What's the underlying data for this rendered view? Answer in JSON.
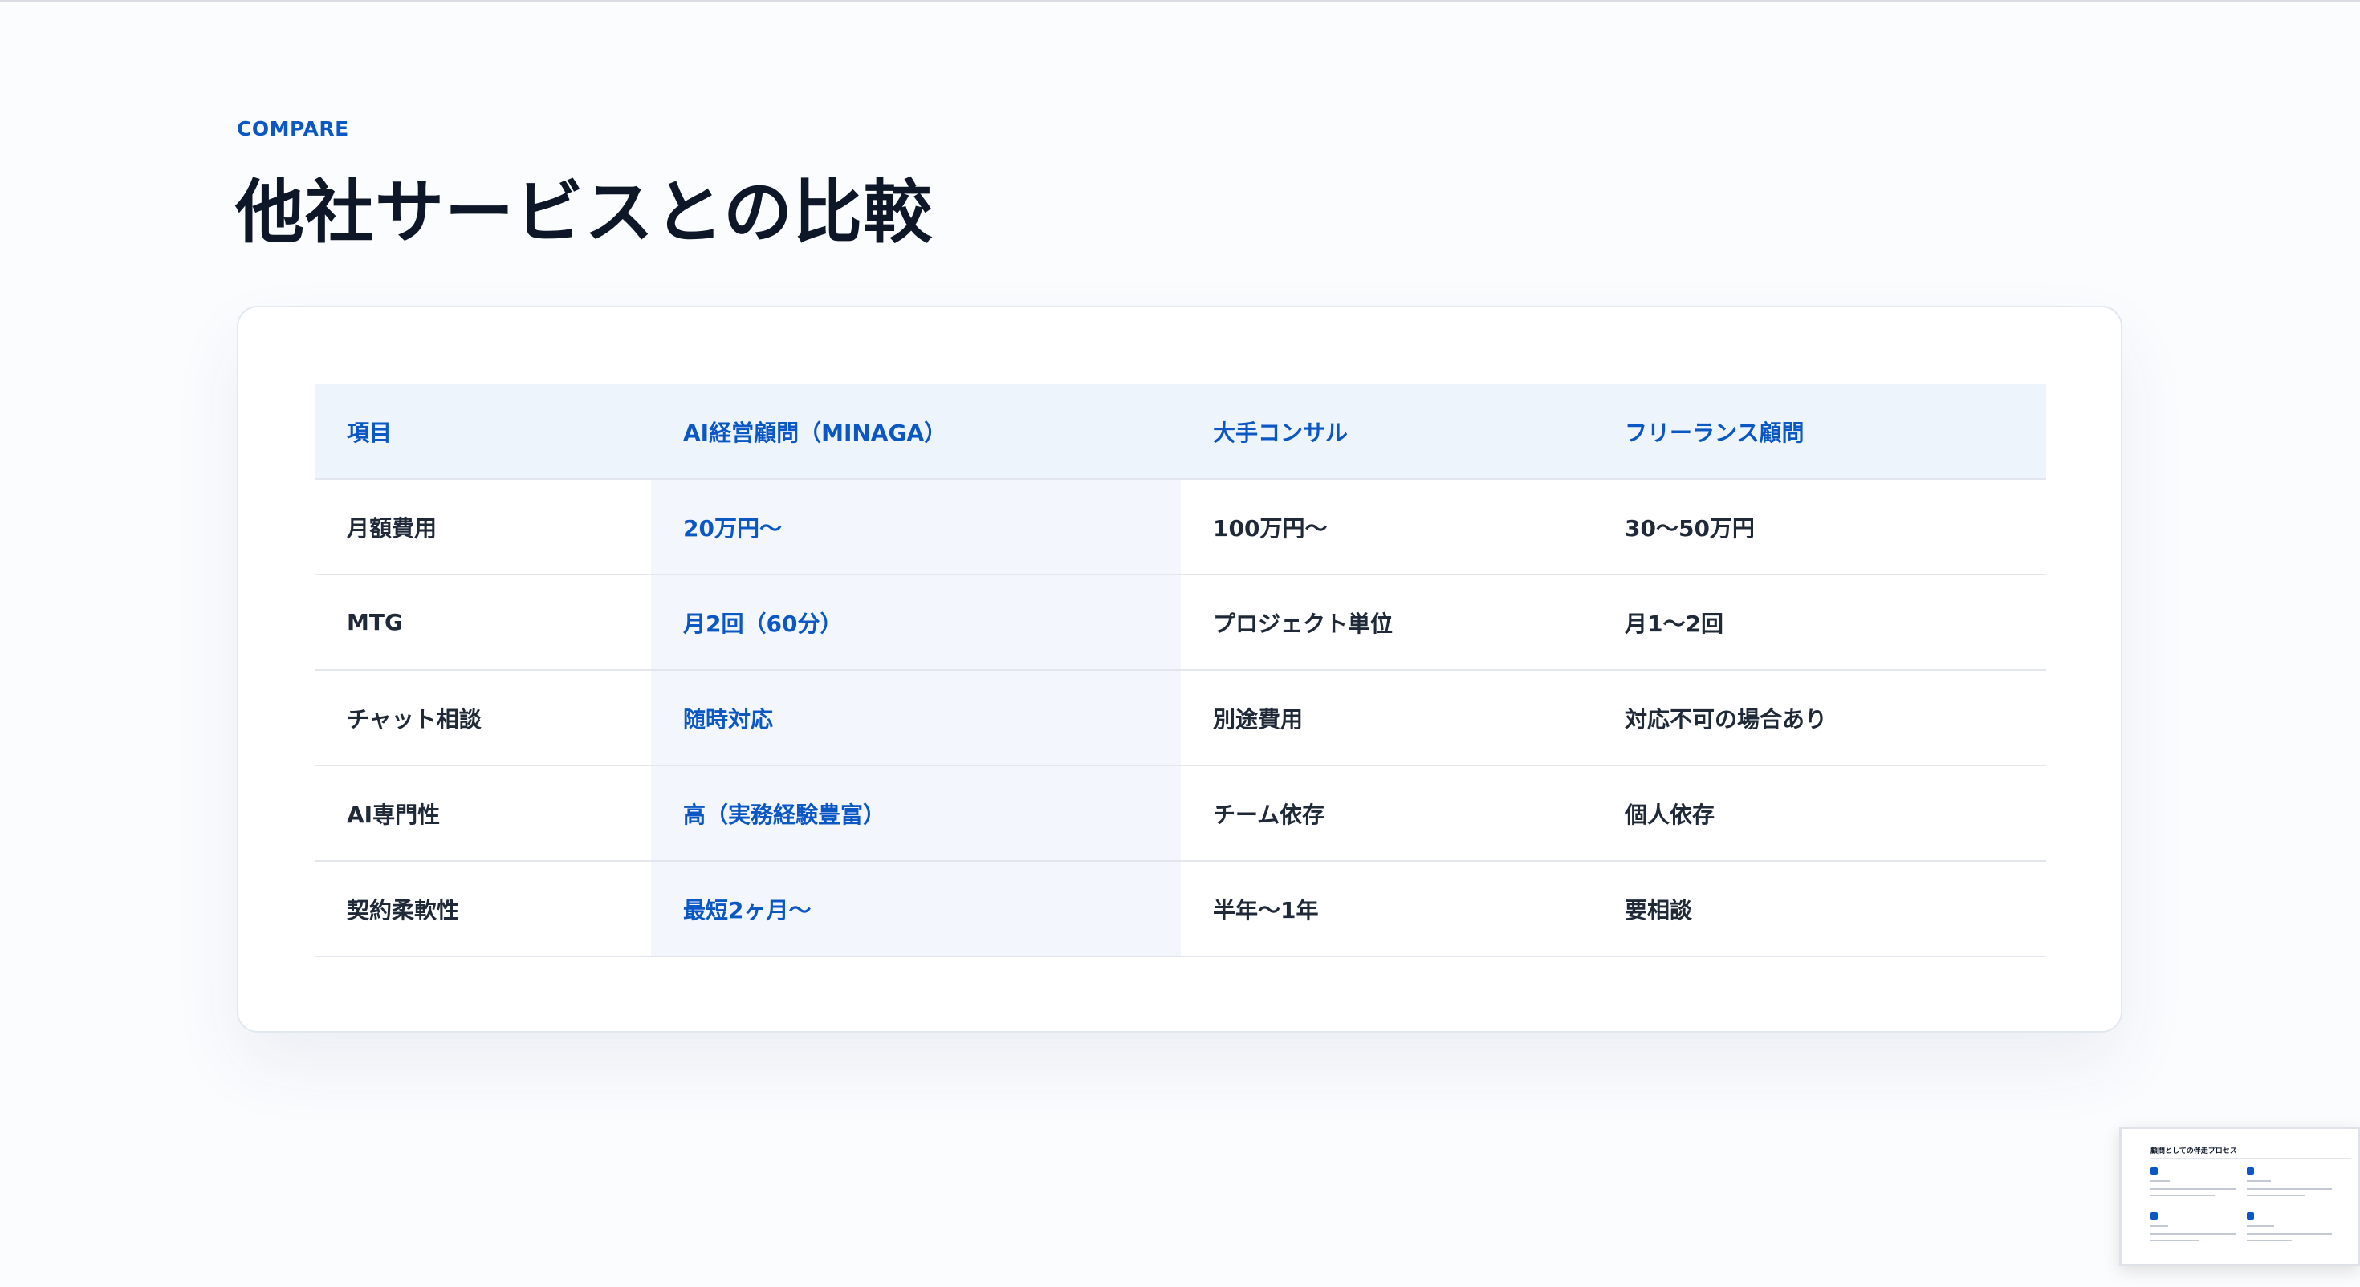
{
  "section": {
    "eyebrow": "COMPARE",
    "title": "他社サービスとの比較"
  },
  "table": {
    "headers": [
      "項目",
      "AI経営顧問（MINAGA）",
      "大手コンサル",
      "フリーランス顧問"
    ],
    "rows": [
      [
        "月額費用",
        "20万円〜",
        "100万円〜",
        "30〜50万円"
      ],
      [
        "MTG",
        "月2回（60分）",
        "プロジェクト単位",
        "月1〜2回"
      ],
      [
        "チャット相談",
        "随時対応",
        "別途費用",
        "対応不可の場合あり"
      ],
      [
        "AI専門性",
        "高（実務経験豊富）",
        "チーム依存",
        "個人依存"
      ],
      [
        "契約柔軟性",
        "最短2ヶ月〜",
        "半年〜1年",
        "要相談"
      ]
    ]
  },
  "preview": {
    "title": "顧問としての伴走プロセス"
  },
  "colors": {
    "accent": "#0b57c4",
    "heading": "#0d1727",
    "header_bg": "#eef4fc",
    "highlight_bg": "#f3f7fd"
  }
}
